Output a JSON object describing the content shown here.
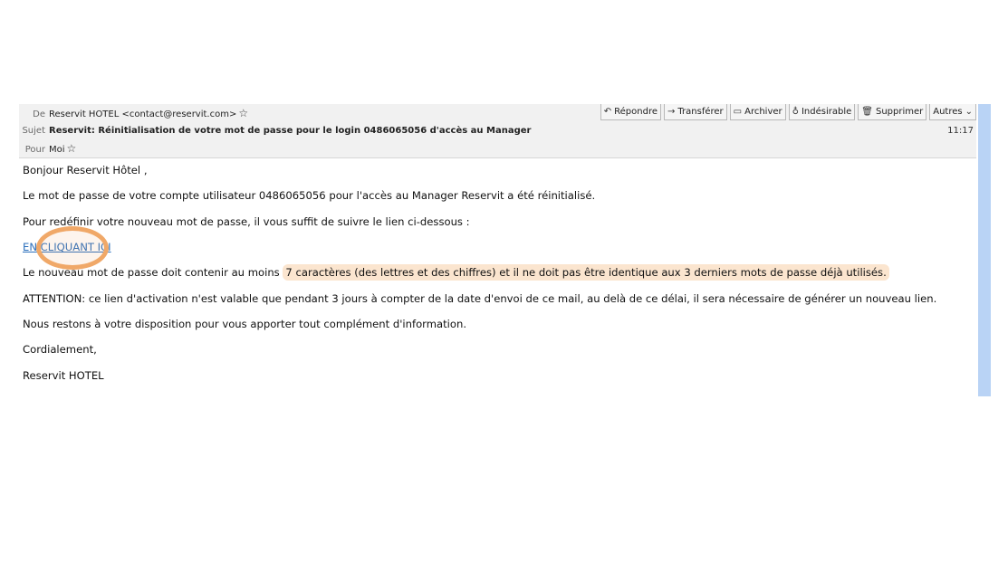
{
  "header": {
    "from_label": "De",
    "from_value": "Reservit HOTEL <contact@reservit.com>",
    "subject_label": "Sujet",
    "subject_value": "Reservit: Réinitialisation de votre mot de passe pour le login 0486065056 d'accès au Manager",
    "to_label": "Pour",
    "to_value": "Moi",
    "time": "11:17",
    "star_icon": "☆"
  },
  "toolbar": {
    "reply": {
      "icon": "↶",
      "label": "Répondre"
    },
    "forward": {
      "icon": "→",
      "label": "Transférer"
    },
    "archive": {
      "icon": "▭",
      "label": "Archiver"
    },
    "junk": {
      "icon": "♁",
      "label": "Indésirable"
    },
    "delete": {
      "icon": "🗑",
      "label": "Supprimer"
    },
    "more": {
      "label": "Autres",
      "icon": "⌄"
    }
  },
  "body": {
    "greeting": "Bonjour Reservit Hôtel ,",
    "line1": "Le mot de passe de votre compte utilisateur 0486065056 pour l'accès au Manager Reservit a été réinitialisé.",
    "line2": "Pour redéfinir votre nouveau mot de passe, il vous suffit de suivre le lien ci-dessous :",
    "link": "EN CLIQUANT ICI",
    "line3_start": "Le nouveau mot de passe doit contenir au moins",
    "line3_highlight": "7 caractères (des lettres et des chiffres) et il ne doit pas être identique aux 3 derniers mots de passe déjà utilisés.",
    "line4": "ATTENTION: ce lien d'activation n'est valable que pendant 3 jours à compter de la date d'envoi de ce mail, au delà de ce délai, il sera nécessaire de générer un nouveau lien.",
    "line5": "Nous restons à votre disposition pour vous apporter tout complément d'information.",
    "line6": "Cordialement,",
    "signature": "Reservit HOTEL"
  },
  "colors": {
    "highlight": "#fbe5cf",
    "circle": "#f0a868",
    "link": "#2a6ebb",
    "scrollbar": "#b9d3f5"
  }
}
